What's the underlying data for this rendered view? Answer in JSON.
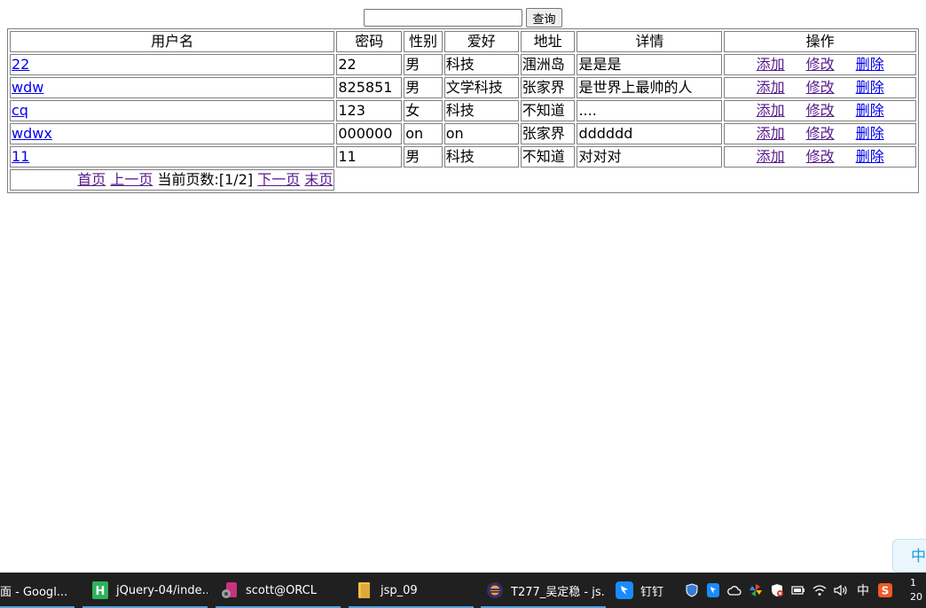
{
  "search": {
    "input_value": "",
    "button_label": "查询"
  },
  "table": {
    "headers": [
      "用户名",
      "密码",
      "性别",
      "爱好",
      "地址",
      "详情",
      "操作"
    ],
    "rows": [
      {
        "username": "22",
        "password": "22",
        "gender": "男",
        "hobby": "科技",
        "address": "涠洲岛",
        "detail": "是是是"
      },
      {
        "username": "wdw",
        "password": "825851",
        "gender": "男",
        "hobby": "文学科技",
        "address": "张家界",
        "detail": "是世界上最帅的人"
      },
      {
        "username": "cq",
        "password": "123",
        "gender": "女",
        "hobby": "科技",
        "address": "不知道",
        "detail": "...."
      },
      {
        "username": "wdwx",
        "password": "000000",
        "gender": "on",
        "hobby": "on",
        "address": "张家界",
        "detail": "dddddd"
      },
      {
        "username": "11",
        "password": "11",
        "gender": "男",
        "hobby": "科技",
        "address": "不知道",
        "detail": "对对对"
      }
    ],
    "actions": {
      "add": "添加",
      "edit": "修改",
      "delete": "删除"
    }
  },
  "pager": {
    "first": "首页",
    "prev": "上一页",
    "current_label": "当前页数:[1/2]",
    "next": "下一页",
    "last": "末页"
  },
  "ime": {
    "label": "中"
  },
  "taskbar": {
    "items": [
      {
        "label": "面 - Googl...",
        "icon": "chrome-icon"
      },
      {
        "label": "jQuery-04/inde...",
        "icon": "hbuilder-icon"
      },
      {
        "label": "scott@ORCL",
        "icon": "database-icon"
      },
      {
        "label": "jsp_09",
        "icon": "folder-icon"
      },
      {
        "label": "T277_吴定稳 - js...",
        "icon": "eclipse-icon"
      },
      {
        "label": "钉钉",
        "icon": "dingtalk-icon"
      }
    ],
    "tray_ime": "中",
    "clock_time": "1",
    "clock_date": "20"
  },
  "colors": {
    "link": "#0000ee",
    "visited_link": "#551a8b",
    "taskbar_bg": "#202020",
    "taskbar_accent": "#4fa3e3",
    "ime_accent": "#1b9ce2"
  }
}
